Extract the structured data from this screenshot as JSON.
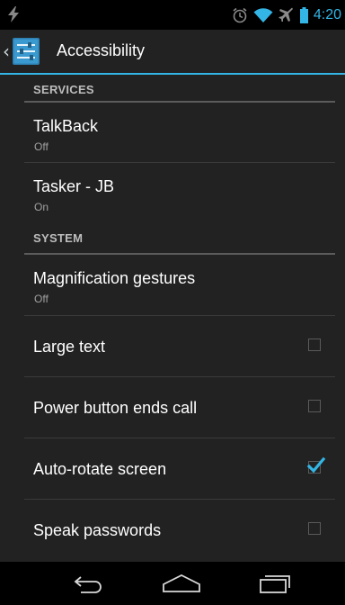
{
  "status_bar": {
    "time": "4:20",
    "icons": [
      "charging-bolt-icon",
      "alarm-icon",
      "wifi-icon",
      "airplane-icon",
      "battery-icon"
    ]
  },
  "action_bar": {
    "title": "Accessibility",
    "icon": "settings-sliders-icon"
  },
  "sections": {
    "services": {
      "header": "SERVICES",
      "items": [
        {
          "label": "TalkBack",
          "summary": "Off"
        },
        {
          "label": "Tasker - JB",
          "summary": "On"
        }
      ]
    },
    "system": {
      "header": "SYSTEM",
      "items": [
        {
          "label": "Magnification gestures",
          "summary": "Off"
        },
        {
          "label": "Large text",
          "checked": false
        },
        {
          "label": "Power button ends call",
          "checked": false
        },
        {
          "label": "Auto-rotate screen",
          "checked": true
        },
        {
          "label": "Speak passwords",
          "checked": false
        }
      ]
    }
  },
  "nav_bar": {
    "icons": [
      "back-icon",
      "home-icon",
      "recents-icon"
    ]
  },
  "colors": {
    "accent": "#33b5e5",
    "background": "#222222",
    "summary_text": "#a0a0a0"
  }
}
